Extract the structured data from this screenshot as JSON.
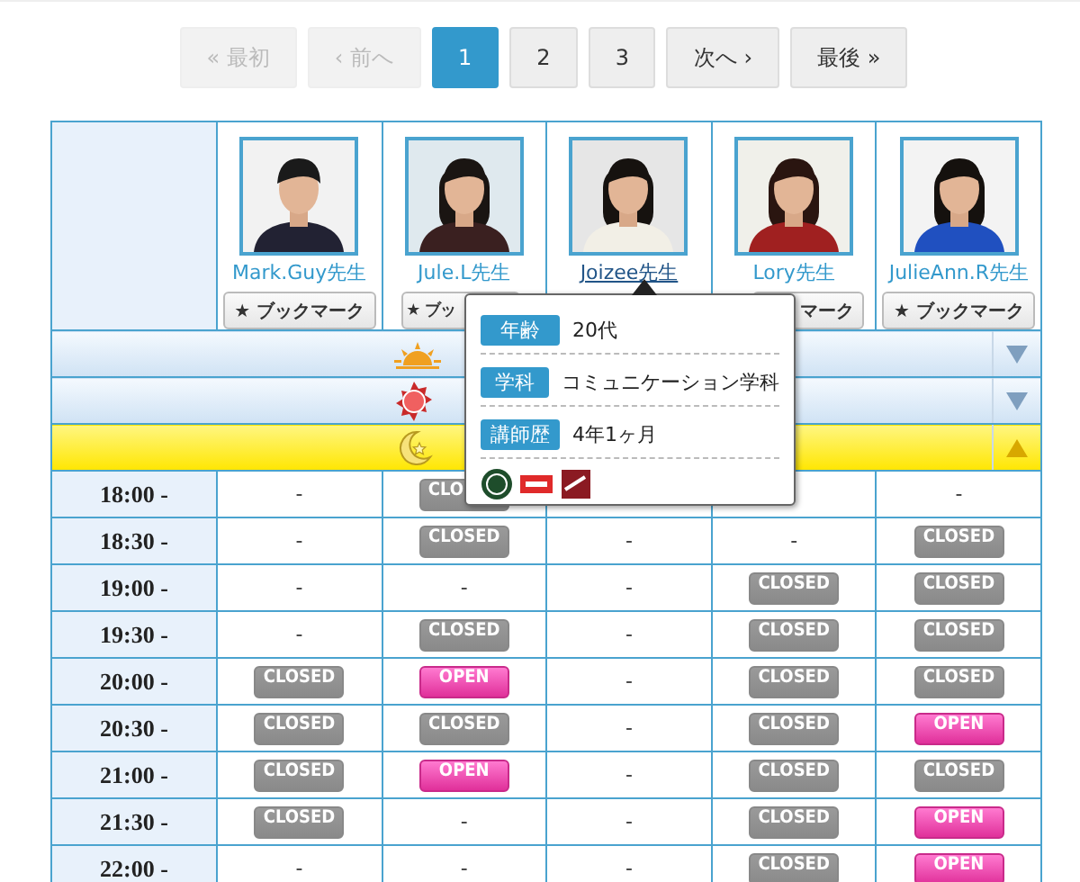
{
  "pagination": [
    {
      "label": "« 最初",
      "disabled": true,
      "selected": false
    },
    {
      "label": "‹ 前へ",
      "disabled": true,
      "selected": false
    },
    {
      "label": "1",
      "disabled": false,
      "selected": true
    },
    {
      "label": "2",
      "disabled": false,
      "selected": false
    },
    {
      "label": "3",
      "disabled": false,
      "selected": false
    },
    {
      "label": "次へ ›",
      "disabled": false,
      "selected": false
    },
    {
      "label": "最後 »",
      "disabled": false,
      "selected": false
    }
  ],
  "teachers": [
    {
      "name": "Mark.Guy先生",
      "hovered": false,
      "bookmark": "★ ブックマーク"
    },
    {
      "name": "Jule.L先生",
      "hovered": false,
      "bookmark": "★ ブッ"
    },
    {
      "name": "Joizee先生",
      "hovered": true
    },
    {
      "name": "Lory先生",
      "hovered": false,
      "bookmark": "マーク"
    },
    {
      "name": "JulieAnn.R先生",
      "hovered": false,
      "bookmark": "★ ブックマーク"
    }
  ],
  "sections": [
    {
      "kind": "morning",
      "expanded": false
    },
    {
      "kind": "noon",
      "expanded": false
    },
    {
      "kind": "night",
      "expanded": true
    }
  ],
  "rows": [
    {
      "time": "18:00 -",
      "cells": [
        {
          "kind": "none",
          "text": "-"
        },
        {
          "kind": "closed",
          "text": "CLO"
        },
        {
          "kind": "hidden"
        },
        {
          "kind": "hidden"
        },
        {
          "kind": "none",
          "text": "-"
        }
      ]
    },
    {
      "time": "18:30 -",
      "cells": [
        {
          "kind": "none",
          "text": "-"
        },
        {
          "kind": "closed",
          "text": "CLOSED"
        },
        {
          "kind": "none",
          "text": "-"
        },
        {
          "kind": "none",
          "text": "-"
        },
        {
          "kind": "closed",
          "text": "CLOSED"
        }
      ]
    },
    {
      "time": "19:00 -",
      "cells": [
        {
          "kind": "none",
          "text": "-"
        },
        {
          "kind": "none",
          "text": "-"
        },
        {
          "kind": "none",
          "text": "-"
        },
        {
          "kind": "closed",
          "text": "CLOSED"
        },
        {
          "kind": "closed",
          "text": "CLOSED"
        }
      ]
    },
    {
      "time": "19:30 -",
      "cells": [
        {
          "kind": "none",
          "text": "-"
        },
        {
          "kind": "closed",
          "text": "CLOSED"
        },
        {
          "kind": "none",
          "text": "-"
        },
        {
          "kind": "closed",
          "text": "CLOSED"
        },
        {
          "kind": "closed",
          "text": "CLOSED"
        }
      ]
    },
    {
      "time": "20:00 -",
      "cells": [
        {
          "kind": "closed",
          "text": "CLOSED"
        },
        {
          "kind": "open",
          "text": "OPEN"
        },
        {
          "kind": "none",
          "text": "-"
        },
        {
          "kind": "closed",
          "text": "CLOSED"
        },
        {
          "kind": "closed",
          "text": "CLOSED"
        }
      ]
    },
    {
      "time": "20:30 -",
      "cells": [
        {
          "kind": "closed",
          "text": "CLOSED"
        },
        {
          "kind": "closed",
          "text": "CLOSED"
        },
        {
          "kind": "none",
          "text": "-"
        },
        {
          "kind": "closed",
          "text": "CLOSED"
        },
        {
          "kind": "open",
          "text": "OPEN"
        }
      ]
    },
    {
      "time": "21:00 -",
      "cells": [
        {
          "kind": "closed",
          "text": "CLOSED"
        },
        {
          "kind": "open",
          "text": "OPEN"
        },
        {
          "kind": "none",
          "text": "-"
        },
        {
          "kind": "closed",
          "text": "CLOSED"
        },
        {
          "kind": "closed",
          "text": "CLOSED"
        }
      ]
    },
    {
      "time": "21:30 -",
      "cells": [
        {
          "kind": "closed",
          "text": "CLOSED"
        },
        {
          "kind": "none",
          "text": "-"
        },
        {
          "kind": "none",
          "text": "-"
        },
        {
          "kind": "closed",
          "text": "CLOSED"
        },
        {
          "kind": "open",
          "text": "OPEN"
        }
      ]
    },
    {
      "time": "22:00 -",
      "cells": [
        {
          "kind": "none",
          "text": "-"
        },
        {
          "kind": "none",
          "text": "-"
        },
        {
          "kind": "none",
          "text": "-"
        },
        {
          "kind": "closed",
          "text": "CLOSED"
        },
        {
          "kind": "open",
          "text": "OPEN"
        }
      ]
    }
  ],
  "tooltip": {
    "rows": [
      {
        "label": "年齢",
        "value": "20代"
      },
      {
        "label": "学科",
        "value": "コミュニケーション学科"
      },
      {
        "label": "講師歴",
        "value": "4年1ヶ月"
      }
    ],
    "badges": [
      {
        "kind": "seal",
        "color": "#1e4d2b"
      },
      {
        "kind": "tag",
        "color": "#e02a2a"
      },
      {
        "kind": "tilted",
        "color": "#8b1a22"
      }
    ]
  }
}
